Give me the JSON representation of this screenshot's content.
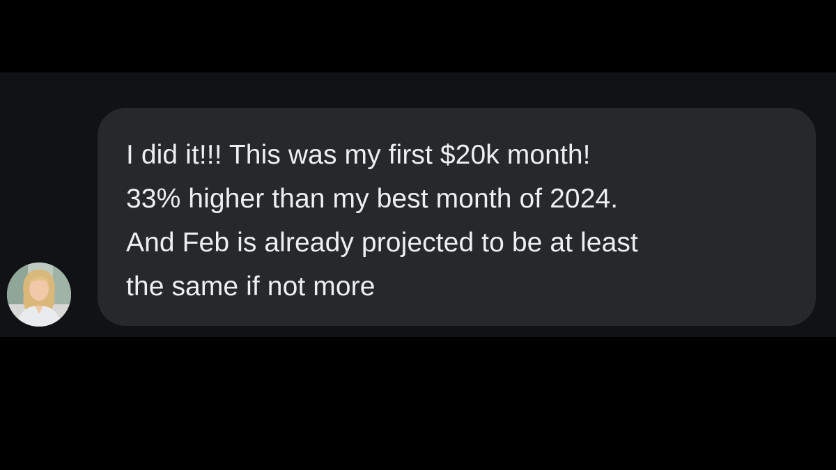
{
  "conversation": {
    "message": {
      "lines": [
        "I did it!!! This was my first $20k month!",
        "33% higher than my best month of 2024.",
        "And Feb is already projected to be at least",
        "the same if not more"
      ]
    },
    "sender": {
      "avatar_icon": "profile-photo-woman-blonde"
    },
    "colors": {
      "page_background": "#000000",
      "chat_background": "#101215",
      "bubble_background": "#26282c",
      "text": "#eeeff1"
    }
  }
}
